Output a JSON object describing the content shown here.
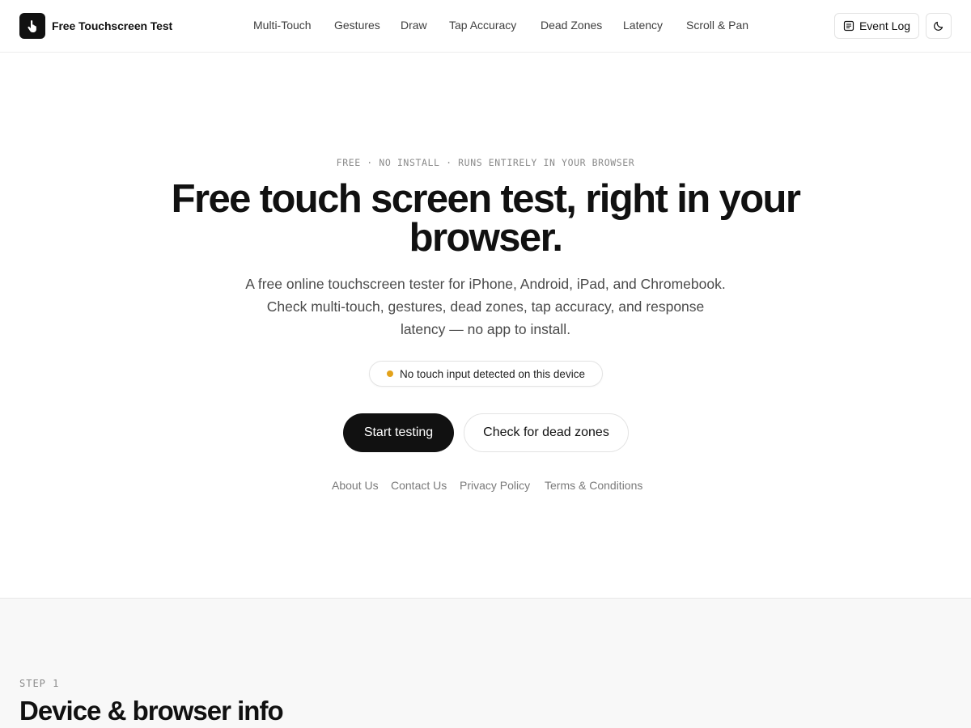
{
  "header": {
    "brand": {
      "name": "Free Touchscreen Test",
      "icon": "hand-pointer-icon"
    },
    "nav": [
      {
        "label": "Multi-Touch"
      },
      {
        "label": "Gestures"
      },
      {
        "label": "Draw"
      },
      {
        "label": "Tap Accuracy"
      },
      {
        "label": "Dead Zones"
      },
      {
        "label": "Latency"
      },
      {
        "label": "Scroll & Pan"
      }
    ],
    "event_log": {
      "label": "Event Log",
      "icon": "document-icon"
    },
    "theme_toggle": {
      "icon": "moon-icon"
    }
  },
  "hero": {
    "eyebrow": "FREE · NO INSTALL · RUNS ENTIRELY IN YOUR BROWSER",
    "title": "Free touch screen test, right in your browser.",
    "description": "A free online touchscreen tester for iPhone, Android, iPad, and Chromebook. Check multi-touch, gestures, dead zones, tap accuracy, and response latency — no app to install.",
    "status": {
      "text": "No touch input detected on this device",
      "color": "#e3a21a"
    },
    "primary_button": "Start testing",
    "secondary_button": "Check for dead zones",
    "links": [
      {
        "label": "About Us"
      },
      {
        "label": "Contact Us"
      },
      {
        "label": "Privacy Policy"
      },
      {
        "label": "Terms & Conditions"
      }
    ]
  },
  "step": {
    "label": "STEP 1",
    "title": "Device & browser info"
  }
}
